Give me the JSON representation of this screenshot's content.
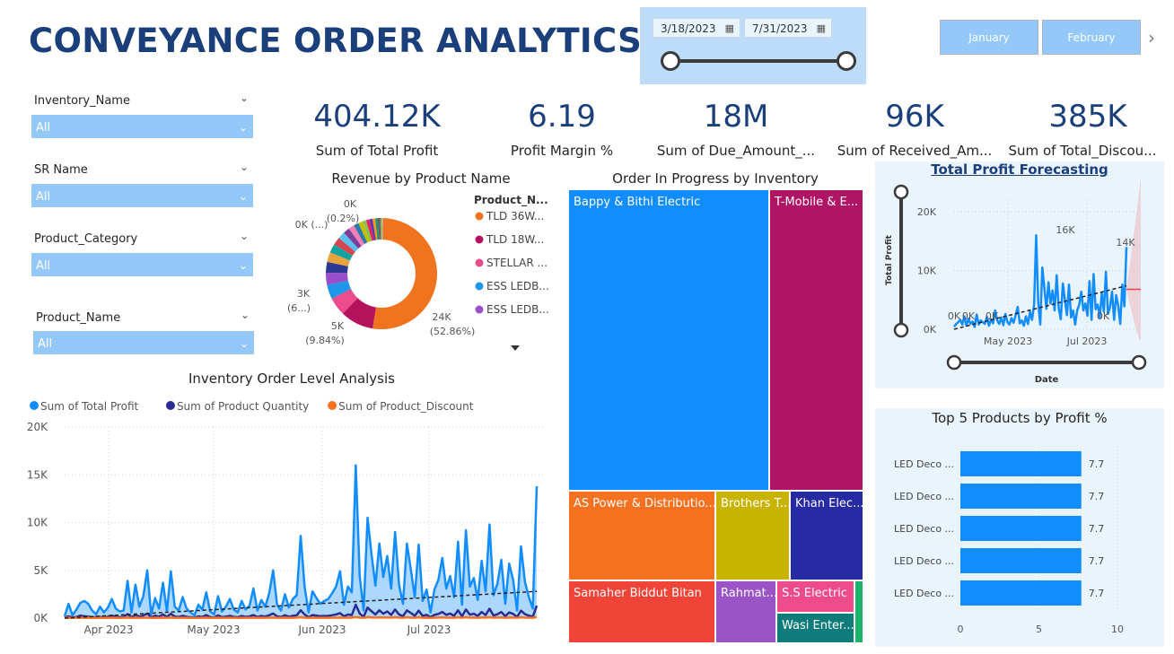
{
  "title": "CONVEYANCE ORDER ANALYTICS",
  "date_slicer": {
    "start": "3/18/2023",
    "end": "7/31/2023",
    "calendar_icon": "calendar-icon"
  },
  "months": [
    "January",
    "February"
  ],
  "slicers": [
    {
      "label": "Inventory_Name",
      "value": "All"
    },
    {
      "label": "SR Name",
      "value": "All"
    },
    {
      "label": "Product_Category",
      "value": "All"
    },
    {
      "label": "Product_Name",
      "value": "All"
    }
  ],
  "kpis": [
    {
      "value": "404.12K",
      "label": "Sum of Total Profit"
    },
    {
      "value": "6.19",
      "label": "Profit Margin %"
    },
    {
      "value": "18M",
      "label": "Sum of Due_Amount_..."
    },
    {
      "value": "96K",
      "label": "Sum of Received_Am..."
    },
    {
      "value": "385K",
      "label": "Sum of Total_Discou..."
    }
  ],
  "colors": {
    "accent": "#1a3f7a",
    "slicer": "#94c8f8",
    "panel": "#eaf4fd",
    "bar": "#118dff"
  },
  "chart_data": [
    {
      "type": "pie",
      "title": "Revenue by Product Name",
      "legend_title": "Product_N...",
      "legend": [
        {
          "name": "TLD 36W...",
          "color": "#f0731f"
        },
        {
          "name": "TLD 18W...",
          "color": "#b5125e"
        },
        {
          "name": "STELLAR ...",
          "color": "#ec4c8c"
        },
        {
          "name": "ESS LEDB...",
          "color": "#1f96e8"
        },
        {
          "name": "ESS LEDB...",
          "color": "#9b4ec9"
        }
      ],
      "slices": [
        {
          "value": 52.86,
          "color": "#f0731f"
        },
        {
          "value": 9.84,
          "color": "#b5125e"
        },
        {
          "value": 5.4,
          "color": "#ec4c8c"
        },
        {
          "value": 4.2,
          "color": "#1f96e8"
        },
        {
          "value": 3.6,
          "color": "#9b4ec9"
        },
        {
          "value": 3.2,
          "color": "#2c3a94"
        },
        {
          "value": 2.9,
          "color": "#e8a33d"
        },
        {
          "value": 2.6,
          "color": "#11a3a0"
        },
        {
          "value": 2.3,
          "color": "#d64550"
        },
        {
          "value": 2.1,
          "color": "#5bc0eb"
        },
        {
          "value": 1.9,
          "color": "#7a3e9d"
        },
        {
          "value": 1.7,
          "color": "#f27fb5"
        },
        {
          "value": 1.5,
          "color": "#2a7ab0"
        },
        {
          "value": 1.3,
          "color": "#c0c000"
        },
        {
          "value": 1.1,
          "color": "#8bc34a"
        },
        {
          "value": 1.0,
          "color": "#e91e63"
        },
        {
          "value": 0.9,
          "color": "#5e35b1"
        },
        {
          "value": 0.8,
          "color": "#ff9800"
        },
        {
          "value": 0.7,
          "color": "#009688"
        },
        {
          "value": 0.6,
          "color": "#795548"
        },
        {
          "value": 0.5,
          "color": "#607d8b"
        },
        {
          "value": 0.3,
          "color": "#cddc39"
        },
        {
          "value": 0.2,
          "color": "#9e9e9e"
        }
      ],
      "labels": [
        {
          "text": "24K",
          "sub": "(52.86%)"
        },
        {
          "text": "5K",
          "sub": "(9.84%)"
        },
        {
          "text": "3K",
          "sub": "(6...)"
        },
        {
          "text": "0K (...)",
          "sub": ""
        },
        {
          "text": "0K",
          "sub": "(0.2%)"
        }
      ]
    },
    {
      "type": "treemap",
      "title": "Order In Progress by Inventory",
      "items": [
        {
          "name": "Bappy & Bithi Electric",
          "color": "#118dff"
        },
        {
          "name": "T-Mobile & E...",
          "color": "#b01464"
        },
        {
          "name": "AS Power & Distributio...",
          "color": "#f57120"
        },
        {
          "name": "Brothers T...",
          "color": "#c8b400"
        },
        {
          "name": "Khan Elec...",
          "color": "#262aa3"
        },
        {
          "name": "Samaher Biddut Bitan",
          "color": "#f04438"
        },
        {
          "name": "Rahmat...",
          "color": "#9a54c6"
        },
        {
          "name": "S.S Electric",
          "color": "#ee4b8b"
        },
        {
          "name": "Wasi Enter...",
          "color": "#0e7c7b"
        },
        {
          "name": "",
          "color": "#1bb46a"
        }
      ]
    },
    {
      "type": "line",
      "title": "Inventory Order Level Analysis",
      "ylim": [
        0,
        20000
      ],
      "y_ticks": [
        "0K",
        "5K",
        "10K",
        "15K",
        "20K"
      ],
      "x_ticks": [
        "Apr 2023",
        "May 2023",
        "Jun 2023",
        "Jul 2023"
      ],
      "series": [
        {
          "name": "Sum of Total Profit",
          "color": "#118dff",
          "values": [
            200,
            1500,
            300,
            900,
            1600,
            1800,
            1500,
            800,
            400,
            1200,
            600,
            1100,
            2000,
            1000,
            700,
            800,
            3900,
            600,
            3500,
            1200,
            2300,
            5000,
            400,
            2100,
            1000,
            3700,
            700,
            4900,
            1200,
            800,
            2200,
            1000,
            600,
            300,
            1400,
            900,
            2700,
            700,
            400,
            2300,
            700,
            1200,
            2000,
            900,
            600,
            1800,
            900,
            1300,
            3100,
            800,
            1900,
            1200,
            2600,
            5000,
            1400,
            800,
            2500,
            1100,
            2000,
            2400,
            8600,
            3300,
            600,
            2800,
            2100,
            1500,
            1800,
            2000,
            2600,
            3300,
            4900,
            1400,
            3300,
            2700,
            16000,
            4400,
            800,
            10500,
            6700,
            3400,
            7800,
            4300,
            6500,
            3100,
            9000,
            3500,
            1500,
            7800,
            5100,
            2200,
            7700,
            1800,
            3000,
            600,
            3000,
            4000,
            6300,
            3100,
            4400,
            2200,
            8000,
            1400,
            9200,
            3300,
            4200,
            1900,
            6000,
            2800,
            9800,
            2400,
            3600,
            6100,
            1500,
            5700,
            4000,
            800,
            7500,
            3800,
            2200,
            1000,
            13800
          ]
        },
        {
          "name": "Sum of Product Quantity",
          "color": "#2a2b92",
          "values": [
            50,
            180,
            60,
            120,
            260,
            200,
            150,
            110,
            80,
            120,
            90,
            140,
            260,
            140,
            110,
            130,
            420,
            90,
            340,
            160,
            280,
            480,
            100,
            260,
            150,
            380,
            120,
            460,
            160,
            120,
            240,
            140,
            100,
            60,
            180,
            130,
            320,
            110,
            70,
            280,
            110,
            160,
            240,
            130,
            100,
            220,
            130,
            180,
            320,
            120,
            230,
            170,
            300,
            480,
            190,
            120,
            300,
            150,
            240,
            300,
            820,
            380,
            90,
            320,
            260,
            200,
            220,
            240,
            300,
            380,
            520,
            190,
            380,
            320,
            1400,
            480,
            120,
            1100,
            720,
            380,
            820,
            460,
            700,
            340,
            900,
            380,
            200,
            800,
            540,
            250,
            780,
            230,
            340,
            100,
            340,
            440,
            640,
            340,
            470,
            250,
            820,
            190,
            900,
            360,
            460,
            230,
            640,
            320,
            980,
            280,
            400,
            640,
            200,
            600,
            440,
            120,
            780,
            420,
            260,
            150,
            1300
          ]
        },
        {
          "name": "Sum of Product_Discount",
          "color": "#f57120",
          "values": [
            20,
            40,
            25,
            35,
            45,
            40,
            30,
            28,
            25,
            30,
            28,
            32,
            45,
            32,
            28,
            30,
            55,
            25,
            50,
            35,
            42,
            60,
            26,
            40,
            32,
            50,
            30,
            58,
            34,
            30,
            40,
            32,
            28,
            22,
            36,
            30,
            46,
            28,
            24,
            42,
            28,
            34,
            40,
            30,
            28,
            38,
            30,
            35,
            48,
            30,
            40,
            35,
            44,
            60,
            36,
            30,
            44,
            32,
            40,
            44,
            90,
            52,
            28,
            46,
            40,
            36,
            38,
            40,
            44,
            50,
            62,
            36,
            50,
            46,
            120,
            58,
            30,
            100,
            76,
            50,
            86,
            58,
            74,
            48,
            94,
            52,
            36,
            84,
            64,
            40,
            82,
            40,
            50,
            28,
            50,
            58,
            72,
            50,
            58,
            40,
            86,
            36,
            92,
            50,
            58,
            40,
            72,
            46,
            98,
            44,
            54,
            72,
            36,
            68,
            56,
            30,
            84,
            54,
            42,
            34,
            110
          ]
        }
      ],
      "trend": {
        "start": 0,
        "end": 2800
      }
    },
    {
      "type": "line",
      "title": "Total Profit Forecasting",
      "ylabel": "Total Profit",
      "xlabel": "Date",
      "ylim": [
        0,
        22000
      ],
      "y_ticks": [
        "0K",
        "10K",
        "20K"
      ],
      "x_ticks": [
        "May 2023",
        "Jul 2023"
      ],
      "annotations": [
        "0K",
        "0K",
        "0K",
        "16K",
        "14K",
        "0K"
      ],
      "series": [
        {
          "name": "Total Profit",
          "color": "#118dff",
          "values": [
            400,
            900,
            1200,
            1600,
            800,
            2200,
            600,
            1800,
            900,
            1300,
            400,
            2500,
            800,
            1500,
            1200,
            900,
            2100,
            600,
            1700,
            1000,
            3200,
            1500,
            900,
            2000,
            700,
            2600,
            1200,
            800,
            1900,
            1100,
            2400,
            3800,
            1000,
            1500,
            600,
            2200,
            900,
            3000,
            1600,
            4200,
            16000,
            4600,
            800,
            10500,
            7000,
            3500,
            8000,
            4400,
            6600,
            3200,
            9200,
            3600,
            1700,
            7800,
            5000,
            2400,
            7600,
            2000,
            3200,
            800,
            3200,
            4200,
            6400,
            3200,
            4400,
            2300,
            8200,
            1600,
            9400,
            3400,
            4200,
            2000,
            6200,
            3000,
            9800,
            2600,
            3800,
            6400,
            1600,
            5800,
            4000,
            900,
            7600,
            3900,
            14000
          ]
        },
        {
          "name": "Forecast",
          "color": "#e8434f",
          "values": [
            6800,
            6800
          ]
        }
      ],
      "trend": {
        "start": 0,
        "end": 7400
      }
    },
    {
      "type": "bar",
      "title": "Top 5 Products by Profit %",
      "orientation": "horizontal",
      "categories": [
        "LED Deco ...",
        "LED Deco ...",
        "LED Deco ...",
        "LED Deco ...",
        "LED Deco ..."
      ],
      "values": [
        7.7,
        7.7,
        7.7,
        7.7,
        7.7
      ],
      "xlim": [
        0,
        10
      ],
      "x_ticks": [
        "0",
        "5",
        "10"
      ]
    }
  ]
}
